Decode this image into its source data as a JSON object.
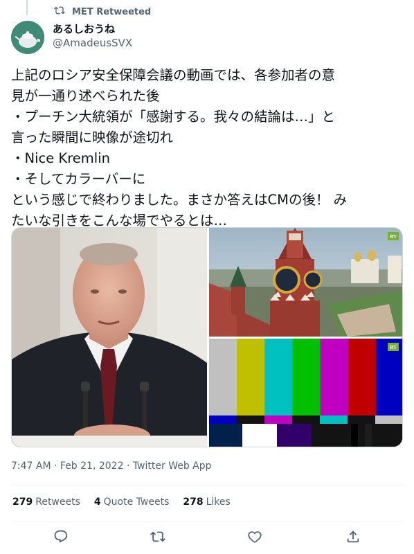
{
  "retweet": {
    "label": "MET Retweeted"
  },
  "author": {
    "display_name": "あるしおうね",
    "handle": "@AmadeusSVX"
  },
  "tweet": {
    "lines": [
      "上記のロシア安全保障会議の動画では、各参加者の意",
      "見が一通り述べられた後",
      "・プーチン大統領が「感謝する。我々の結論は…」と",
      "言った瞬間に映像が途切れ",
      "・Nice Kremlin",
      "・そしてカラーバーに",
      "という感じで終わりました。まさか答えはCMの後！ み",
      "たいな引きをこんな場でやるとは…"
    ]
  },
  "media": {
    "images": [
      {
        "icon": "speaker-at-podium-photo"
      },
      {
        "icon": "kremlin-clock-tower-photo",
        "badge": "RT"
      },
      {
        "icon": "color-bars-test-pattern",
        "badge": "RT"
      }
    ],
    "color_bars": [
      "#c0c0c0",
      "#c0c000",
      "#00c0c0",
      "#00c000",
      "#c000c0",
      "#c00000",
      "#0000c0"
    ]
  },
  "meta": {
    "timestamp": "7:47 AM · Feb 21, 2022 · Twitter Web App"
  },
  "stats": {
    "retweets_count": "279",
    "retweets_label": "Retweets",
    "quotes_count": "4",
    "quotes_label": "Quote Tweets",
    "likes_count": "278",
    "likes_label": "Likes"
  },
  "actions": [
    "reply-icon",
    "retweet-icon",
    "like-icon",
    "share-icon"
  ]
}
